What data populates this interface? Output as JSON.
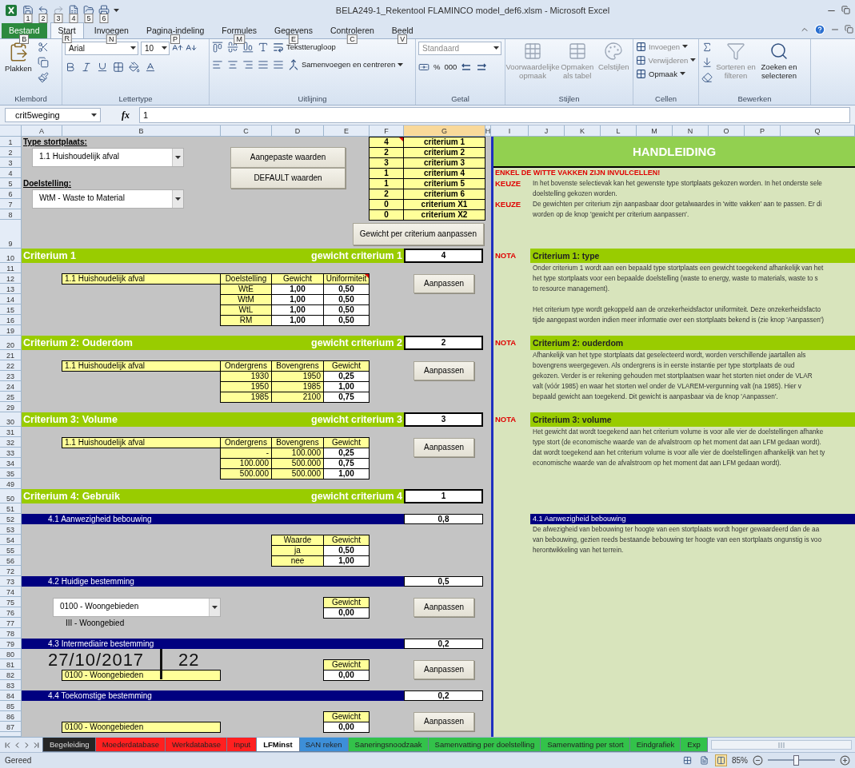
{
  "window": {
    "title": "BELA249-1_Rekentool FLAMINCO model_def6.xlsm - Microsoft Excel"
  },
  "quick_access_keytips": [
    "1",
    "2",
    "3",
    "4",
    "5",
    "6"
  ],
  "ribbon_tabs": [
    {
      "label": "Bestand",
      "keytip": "B",
      "selected": false,
      "kind": "file"
    },
    {
      "label": "Start",
      "keytip": "R",
      "selected": true,
      "kind": "tab"
    },
    {
      "label": "Invoegen",
      "keytip": "N",
      "selected": false,
      "kind": "tab"
    },
    {
      "label": "Pagina-indeling",
      "keytip": "P",
      "selected": false,
      "kind": "tab"
    },
    {
      "label": "Formules",
      "keytip": "M",
      "selected": false,
      "kind": "tab"
    },
    {
      "label": "Gegevens",
      "keytip": "E",
      "selected": false,
      "kind": "tab"
    },
    {
      "label": "Controleren",
      "keytip": "C",
      "selected": false,
      "kind": "tab"
    },
    {
      "label": "Beeld",
      "keytip": "V",
      "selected": false,
      "kind": "tab"
    }
  ],
  "ribbon_groups": [
    {
      "kind": "clipboard",
      "label": "Klembord",
      "paste": "Plakken"
    },
    {
      "kind": "font",
      "label": "Lettertype",
      "font": "Arial",
      "size": "10"
    },
    {
      "kind": "alignment",
      "label": "Uitlijning",
      "wrap": "Tekstterugloop",
      "merge": "Samenvoegen en centreren"
    },
    {
      "kind": "number",
      "label": "Getal",
      "format": "Standaard",
      "format_disabled": true,
      "buttons": [
        "%",
        "000"
      ]
    },
    {
      "kind": "styles",
      "label": "Stijlen",
      "items": [
        {
          "label": "Voorwaardelijke opmaak",
          "disabled": true
        },
        {
          "label": "Opmaken als tabel",
          "disabled": true
        },
        {
          "label": "Celstijlen",
          "disabled": true
        }
      ]
    },
    {
      "kind": "cells",
      "label": "Cellen",
      "items": [
        {
          "label": "Invoegen",
          "disabled": true
        },
        {
          "label": "Verwijderen",
          "disabled": true
        },
        {
          "label": "Opmaak",
          "disabled": false
        }
      ]
    },
    {
      "kind": "editing",
      "label": "Bewerken",
      "items": [
        {
          "label": "Sorteren en filteren",
          "disabled": true
        },
        {
          "label": "Zoeken en selecteren",
          "disabled": false
        }
      ]
    }
  ],
  "formula_bar": {
    "name_box": "crit5weging",
    "fx": "fx",
    "value": "1"
  },
  "columns": [
    {
      "label": "A",
      "selected": false
    },
    {
      "label": "B",
      "selected": false
    },
    {
      "label": "C",
      "selected": false
    },
    {
      "label": "D",
      "selected": false
    },
    {
      "label": "E",
      "selected": false
    },
    {
      "label": "F",
      "selected": false
    },
    {
      "label": "G",
      "selected": true
    },
    {
      "label": "H",
      "selected": false
    },
    {
      "label": "I",
      "selected": false
    },
    {
      "label": "J",
      "selected": false
    },
    {
      "label": "K",
      "selected": false
    },
    {
      "label": "L",
      "selected": false
    },
    {
      "label": "M",
      "selected": false
    },
    {
      "label": "N",
      "selected": false
    },
    {
      "label": "O",
      "selected": false
    },
    {
      "label": "P",
      "selected": false
    },
    {
      "label": "Q",
      "selected": false
    }
  ],
  "row_numbers": [
    "1",
    "2",
    "3",
    "4",
    "5",
    "6",
    "7",
    "8",
    "9",
    "10",
    "11",
    "12",
    "13",
    "14",
    "15",
    "16",
    "19",
    "20",
    "21",
    "22",
    "23",
    "24",
    "25",
    "29",
    "30",
    "31",
    "32",
    "33",
    "34",
    "35",
    "49",
    "50",
    "51",
    "52",
    "53",
    "54",
    "55",
    "56",
    "72",
    "73",
    "74",
    "75",
    "76",
    "77",
    "78",
    "79",
    "80",
    "81",
    "82",
    "83",
    "84",
    "85",
    "86",
    "87"
  ],
  "setup": {
    "type_label": "Type stortplaats:",
    "type_value": "1.1 Huishoudelijk afval",
    "goal_label": "Doelstelling:",
    "goal_value": "WtM - Waste to Material",
    "buttons": [
      "Aangepaste waarden",
      "DEFAULT waarden"
    ],
    "weights": [
      {
        "value": "4",
        "label": "criterium 1",
        "comment": true
      },
      {
        "value": "2",
        "label": "criterium 2",
        "comment": false
      },
      {
        "value": "3",
        "label": "criterium 3",
        "comment": false
      },
      {
        "value": "1",
        "label": "criterium 4",
        "comment": false
      },
      {
        "value": "1",
        "label": "criterium 5",
        "comment": false
      },
      {
        "value": "2",
        "label": "criterium 6",
        "comment": false
      },
      {
        "value": "0",
        "label": "criterium X1",
        "comment": false
      },
      {
        "value": "0",
        "label": "criterium X2",
        "comment": false
      }
    ],
    "adjust_button": "Gewicht per criterium aanpassen"
  },
  "criteria": [
    {
      "title": "Criterium 1",
      "weight_label": "gewicht criterium 1",
      "weight": "4",
      "button": "Aanpassen",
      "table": {
        "kind": "target",
        "header_comment": true,
        "header": [
          "1.1 Huishoudelijk afval",
          "Doelstelling",
          "Gewicht",
          "Uniformiteit"
        ],
        "rows": [
          [
            "WtE",
            "1,00",
            "0,50"
          ],
          [
            "WtM",
            "1,00",
            "0,50"
          ],
          [
            "WtL",
            "1,00",
            "0,50"
          ],
          [
            "RM",
            "1,00",
            "0,50"
          ]
        ]
      }
    },
    {
      "title": "Criterium 2: Ouderdom",
      "weight_label": "gewicht criterium 2",
      "weight": "2",
      "button": "Aanpassen",
      "table": {
        "kind": "range",
        "header_comment": false,
        "header": [
          "1.1 Huishoudelijk afval",
          "Ondergrens",
          "Bovengrens",
          "Gewicht"
        ],
        "rows": [
          [
            "1930",
            "1950",
            "0,25"
          ],
          [
            "1950",
            "1985",
            "1,00"
          ],
          [
            "1985",
            "2100",
            "0,75"
          ]
        ]
      }
    },
    {
      "title": "Criterium 3: Volume",
      "weight_label": "gewicht criterium 3",
      "weight": "3",
      "button": "Aanpassen",
      "table": {
        "kind": "range",
        "header_comment": false,
        "header": [
          "1.1 Huishoudelijk afval",
          "Ondergrens",
          "Bovengrens",
          "Gewicht"
        ],
        "rows": [
          [
            "-",
            "100.000",
            "0,25"
          ],
          [
            "100.000",
            "500.000",
            "0,75"
          ],
          [
            "500.000",
            "500.000",
            "1,00"
          ]
        ]
      }
    },
    {
      "title": "Criterium 4: Gebruik",
      "weight_label": "gewicht criterium 4",
      "weight": "1",
      "subsections": [
        {
          "kind": "lookup",
          "title": "4.1 Aanwezigheid bebouwing",
          "weight": "0,8",
          "header": [
            "Waarde",
            "Gewicht"
          ],
          "rows": [
            [
              "ja",
              "0,50"
            ],
            [
              "nee",
              "1,00"
            ]
          ]
        },
        {
          "kind": "dropdown",
          "title": "4.2 Huidige bestemming",
          "weight": "0,5",
          "select": "0100 - Woongebieden",
          "note": "III - Woongebied",
          "weight_header": "Gewicht",
          "weight_value": "0,00",
          "button": "Aanpassen"
        },
        {
          "kind": "field",
          "title": "4.3 Intermediaire bestemming",
          "weight": "0,2",
          "value": "0100 - Woongebieden",
          "weight_header": "Gewicht",
          "weight_value": "0,00",
          "button": "Aanpassen"
        },
        {
          "kind": "field",
          "title": "4.4 Toekomstige bestemming",
          "weight": "0,2",
          "value": "0100 - Woongebieden",
          "weight_header": "Gewicht",
          "weight_value": "0,00",
          "button": "Aanpassen"
        }
      ]
    }
  ],
  "overlay_stamp": {
    "date": "27/10/2017",
    "number": "22"
  },
  "manual": {
    "title": "HANDLEIDING",
    "warning": "ENKEL DE WITTE VAKKEN ZIJN INVULCELLEN!",
    "notes": [
      {
        "kind": "keuze",
        "tag": "KEUZE",
        "paragraphs": [
          [
            "In het bovenste selectievak kan het gewenste type stortplaats gekozen worden. In het onderste sele",
            "doelstelling gekozen worden."
          ]
        ]
      },
      {
        "kind": "keuze",
        "tag": "KEUZE",
        "paragraphs": [
          [
            "De gewichten per criterium zijn aanpasbaar door getalwaardes in 'witte vakken' aan te passen. Er di",
            "worden op de knop 'gewicht per criterium aanpassen'."
          ]
        ]
      },
      {
        "kind": "nota",
        "tag": "NOTA",
        "heading": "Criterium 1: type",
        "paragraphs": [
          [
            "Onder criterium 1 wordt aan een bepaald type stortplaats een gewicht toegekend afhankelijk van het",
            "het type stortplaats voor een bepaalde doelstelling (waste to energy, waste to materials, waste to s",
            "to resource management)."
          ],
          [
            "Het criterium type wordt gekoppeld aan de onzekerheidsfactor uniformiteit. Deze onzekerheidsfacto",
            "tijde aangepast worden indien meer informatie over een stortplaats bekend is (zie knop 'Aanpassen')"
          ]
        ]
      },
      {
        "kind": "nota",
        "tag": "NOTA",
        "heading": "Criterium 2: ouderdom",
        "paragraphs": [
          [
            "Afhankelijk van het type stortplaats dat geselecteerd wordt, worden verschillende jaartallen als",
            "bovengrens weergegeven. Als ondergrens is in eerste instantie per type stortplaats de oud",
            "gekozen. Verder is er rekening gehouden met stortplaatsen waar het storten niet onder de VLAR",
            "valt (vóór 1985) en waar het storten wel onder de VLAREM-vergunning valt (na 1985). Hier v",
            "bepaald gewicht aan toegekend. Dit gewicht is aanpasbaar via de knop 'Aanpassen'."
          ]
        ]
      },
      {
        "kind": "nota",
        "tag": "NOTA",
        "heading": "Criterium 3: volume",
        "paragraphs": [
          [
            "Het gewicht dat wordt toegekend aan het criterium volume is voor alle vier de doelstellingen afhanke",
            "type stort (de economische waarde van de afvalstroom op het moment dat aan LFM gedaan wordt).",
            "dat wordt toegekend aan het criterium volume is voor alle vier de doelstellingen afhankelijk van het ty",
            "economische waarde van de afvalstroom op het moment dat aan LFM gedaan wordt)."
          ]
        ]
      },
      {
        "kind": "section",
        "heading": "4.1 Aanwezigheid bebouwing",
        "paragraphs": [
          [
            "De afwezigheid van bebouwing ter hoogte van een stortplaats wordt hoger gewaardeerd dan de aa",
            "van bebouwing, gezien reeds bestaande bebouwing ter hoogte van een stortplaats ongunstig is voo",
            "herontwikkeling van het terrein."
          ]
        ]
      }
    ]
  },
  "sheet_tabs": [
    {
      "label": "Begeleiding",
      "selected": false,
      "color": "#262626"
    },
    {
      "label": "Moederdatabase",
      "selected": false,
      "color": "#ff2020"
    },
    {
      "label": "Werkdatabase",
      "selected": false,
      "color": "#ff2020"
    },
    {
      "label": "Input",
      "selected": false,
      "color": "#ff2020"
    },
    {
      "label": "LFMinst",
      "selected": true,
      "color": "#ffffff"
    },
    {
      "label": "SAN reken",
      "selected": false,
      "color": "#3d8fd8"
    },
    {
      "label": "Saneringsnoodzaak",
      "selected": false,
      "color": "#33c24a"
    },
    {
      "label": "Samenvatting per doelstelling",
      "selected": false,
      "color": "#33c24a"
    },
    {
      "label": "Samenvatting per stort",
      "selected": false,
      "color": "#33c24a"
    },
    {
      "label": "Eindgrafiek",
      "selected": false,
      "color": "#33c24a"
    },
    {
      "label": "Exp",
      "selected": false,
      "color": "#33c24a"
    }
  ],
  "status_bar": {
    "text": "Gereed",
    "zoom": "85%",
    "zoom_slider": {
      "level": 0.42
    }
  }
}
